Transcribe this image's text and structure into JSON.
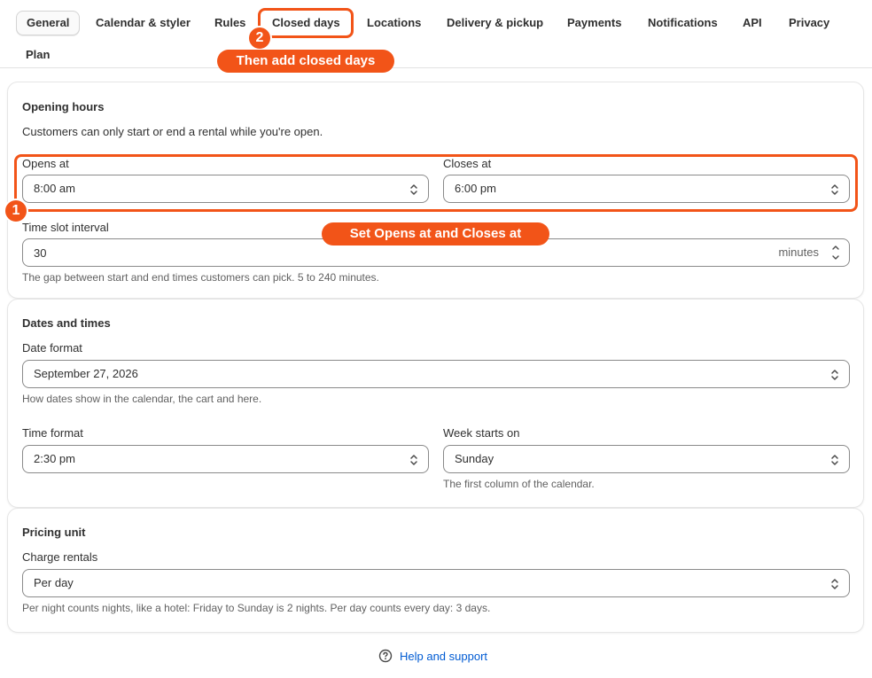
{
  "tabs": [
    {
      "label": "General",
      "active": true
    },
    {
      "label": "Calendar & styler"
    },
    {
      "label": "Rules"
    },
    {
      "label": "Closed days"
    },
    {
      "label": "Locations"
    },
    {
      "label": "Delivery & pickup"
    },
    {
      "label": "Payments"
    },
    {
      "label": "Notifications"
    },
    {
      "label": "API"
    },
    {
      "label": "Privacy"
    },
    {
      "label": "Plan"
    }
  ],
  "annotations": {
    "step1": {
      "number": "1",
      "callout": "Set Opens at and Closes at"
    },
    "step2": {
      "number": "2",
      "callout": "Then add closed days"
    },
    "accent_color": "#f25418"
  },
  "opening_hours": {
    "title": "Opening hours",
    "description": "Customers can only start or end a rental while you're open.",
    "opens_label": "Opens at",
    "opens_value": "8:00 am",
    "closes_label": "Closes at",
    "closes_value": "6:00 pm",
    "interval_label": "Time slot interval",
    "interval_value": "30",
    "interval_suffix": "minutes",
    "interval_help": "The gap between start and end times customers can pick. 5 to 240 minutes."
  },
  "dates_times": {
    "title": "Dates and times",
    "date_format_label": "Date format",
    "date_format_value": "September 27, 2026",
    "date_format_help": "How dates show in the calendar, the cart and here.",
    "time_format_label": "Time format",
    "time_format_value": "2:30 pm",
    "week_start_label": "Week starts on",
    "week_start_value": "Sunday",
    "week_start_help": "The first column of the calendar."
  },
  "pricing": {
    "title": "Pricing unit",
    "charge_label": "Charge rentals",
    "charge_value": "Per day",
    "charge_help": "Per night counts nights, like a hotel: Friday to Sunday is 2 nights. Per day counts every day: 3 days."
  },
  "footer": {
    "help_label": "Help and support",
    "help_icon": "question-circle-icon",
    "link_color": "#005bd3"
  }
}
